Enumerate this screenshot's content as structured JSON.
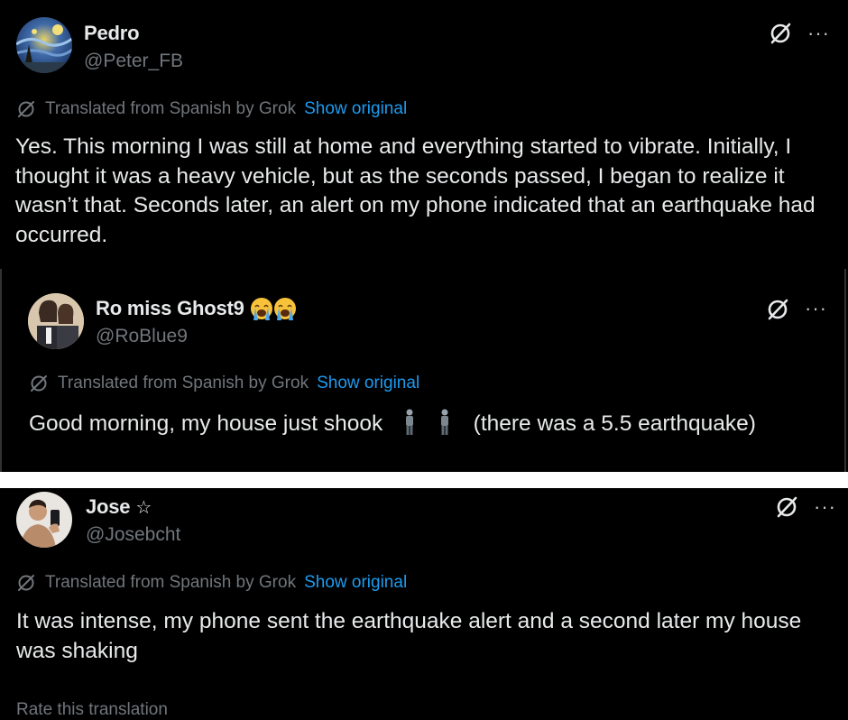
{
  "posts": [
    {
      "name": "Pedro",
      "handle": "@Peter_FB",
      "translation_note": "Translated from Spanish by Grok",
      "show_original": "Show original",
      "text": "Yes. This morning I was still at home and everything started to vibrate. Initially, I thought it was a heavy vehicle, but as the seconds passed, I began to realize it wasn’t that. Seconds later, an alert on my phone indicated that an earthquake had occurred."
    },
    {
      "name": "Ro miss Ghost9",
      "name_emojis": [
        "crying-face-emoji",
        "crying-face-emoji"
      ],
      "handle": "@RoBlue9",
      "translation_note": "Translated from Spanish by Grok",
      "show_original": "Show original",
      "text_before": "Good morning, my house just shook",
      "text_icons": [
        "standing-person-icon",
        "standing-person-icon"
      ],
      "text_after": "(there was a 5.5 earthquake)"
    },
    {
      "name": "Jose",
      "name_badge": "☆",
      "handle": "@Josebcht",
      "translation_note": "Translated from Spanish by Grok",
      "show_original": "Show original",
      "text": "It was intense, my phone sent the earthquake alert and a second later my house was shaking"
    }
  ],
  "more_label": "···",
  "footer_cutoff": "Rate this translation",
  "colors": {
    "background": "#000000",
    "primary_text": "#e7e9ea",
    "secondary_text": "#71767b",
    "link": "#1d9bf0",
    "border": "#2f3336"
  },
  "icons": {
    "grok": "grok-slash-icon",
    "more": "more-options-icon"
  }
}
